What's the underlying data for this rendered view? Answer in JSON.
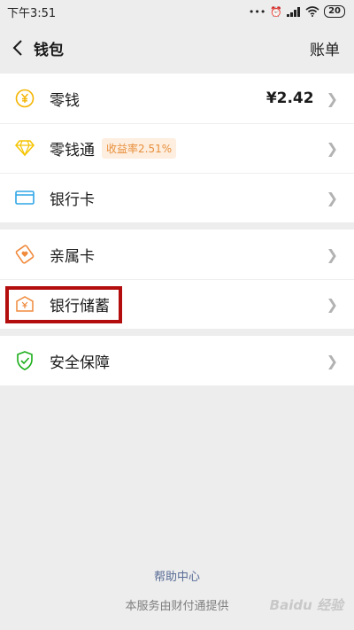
{
  "status_bar": {
    "time": "下午3:51",
    "battery": "20"
  },
  "nav": {
    "title": "钱包",
    "right_label": "账单"
  },
  "groups": [
    {
      "items": [
        {
          "label": "零钱",
          "value": "¥2.42",
          "icon": "yuan-coin-icon"
        },
        {
          "label": "零钱通",
          "badge": "收益率2.51%",
          "icon": "diamond-icon"
        },
        {
          "label": "银行卡",
          "icon": "bank-card-icon"
        }
      ]
    },
    {
      "items": [
        {
          "label": "亲属卡",
          "icon": "heart-card-icon"
        },
        {
          "label": "银行储蓄",
          "icon": "bank-savings-icon"
        }
      ]
    },
    {
      "items": [
        {
          "label": "安全保障",
          "icon": "shield-check-icon"
        }
      ]
    }
  ],
  "footer": {
    "help": "帮助中心",
    "provider": "本服务由财付通提供"
  },
  "watermark": "Baidu 经验",
  "colors": {
    "coin": "#f5b400",
    "diamond": "#f5c400",
    "card": "#2fa5e6",
    "orange": "#f08a3c",
    "shield": "#1aad19",
    "link": "#576b95",
    "highlight": "#b30d0d"
  }
}
